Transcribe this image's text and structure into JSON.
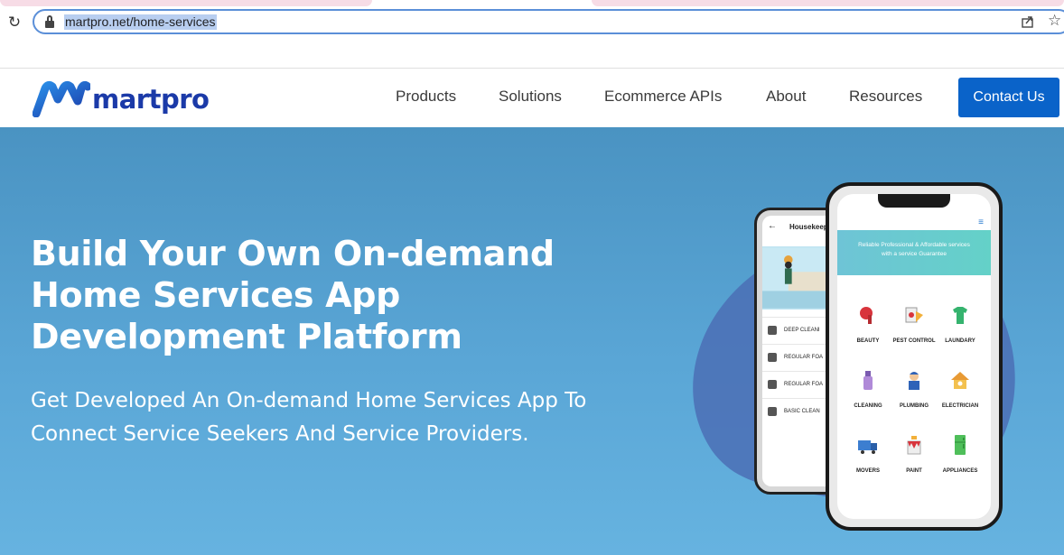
{
  "browser": {
    "url": "martpro.net/home-services",
    "reload_icon": "↻",
    "bookmark_icon": "☆"
  },
  "nav": {
    "logo_text": "martpro",
    "menu": [
      "Products",
      "Solutions",
      "Ecommerce APIs",
      "About",
      "Resources"
    ],
    "contact": "Contact Us"
  },
  "hero": {
    "headline": "Build Your Own On-demand Home Services App Development Platform",
    "subline": "Get Developed An On-demand Home Services App To Connect Service Seekers And Service Providers."
  },
  "phone_back": {
    "back_icon": "←",
    "title": "Housekeep",
    "rows": [
      "DEEP CLEANI",
      "REGULAR FOA",
      "REGULAR FOA",
      "BASIC CLEAN"
    ]
  },
  "phone_front": {
    "menu_icon": "≡",
    "banner_line1": "Reliable Professional & Affordable services",
    "banner_line2": "with a service Guarantee",
    "services": [
      "BEAUTY",
      "PEST CONTROL",
      "LAUNDARY",
      "CLEANING",
      "PLUMBING",
      "ELECTRICIAN",
      "MOVERS",
      "PAINT",
      "APPLIANCES"
    ]
  },
  "colors": {
    "brand": "#1b3aa8",
    "cta": "#0a63c9",
    "hero_bg": "#5aa6d6",
    "blob": "#4b6fb5"
  }
}
